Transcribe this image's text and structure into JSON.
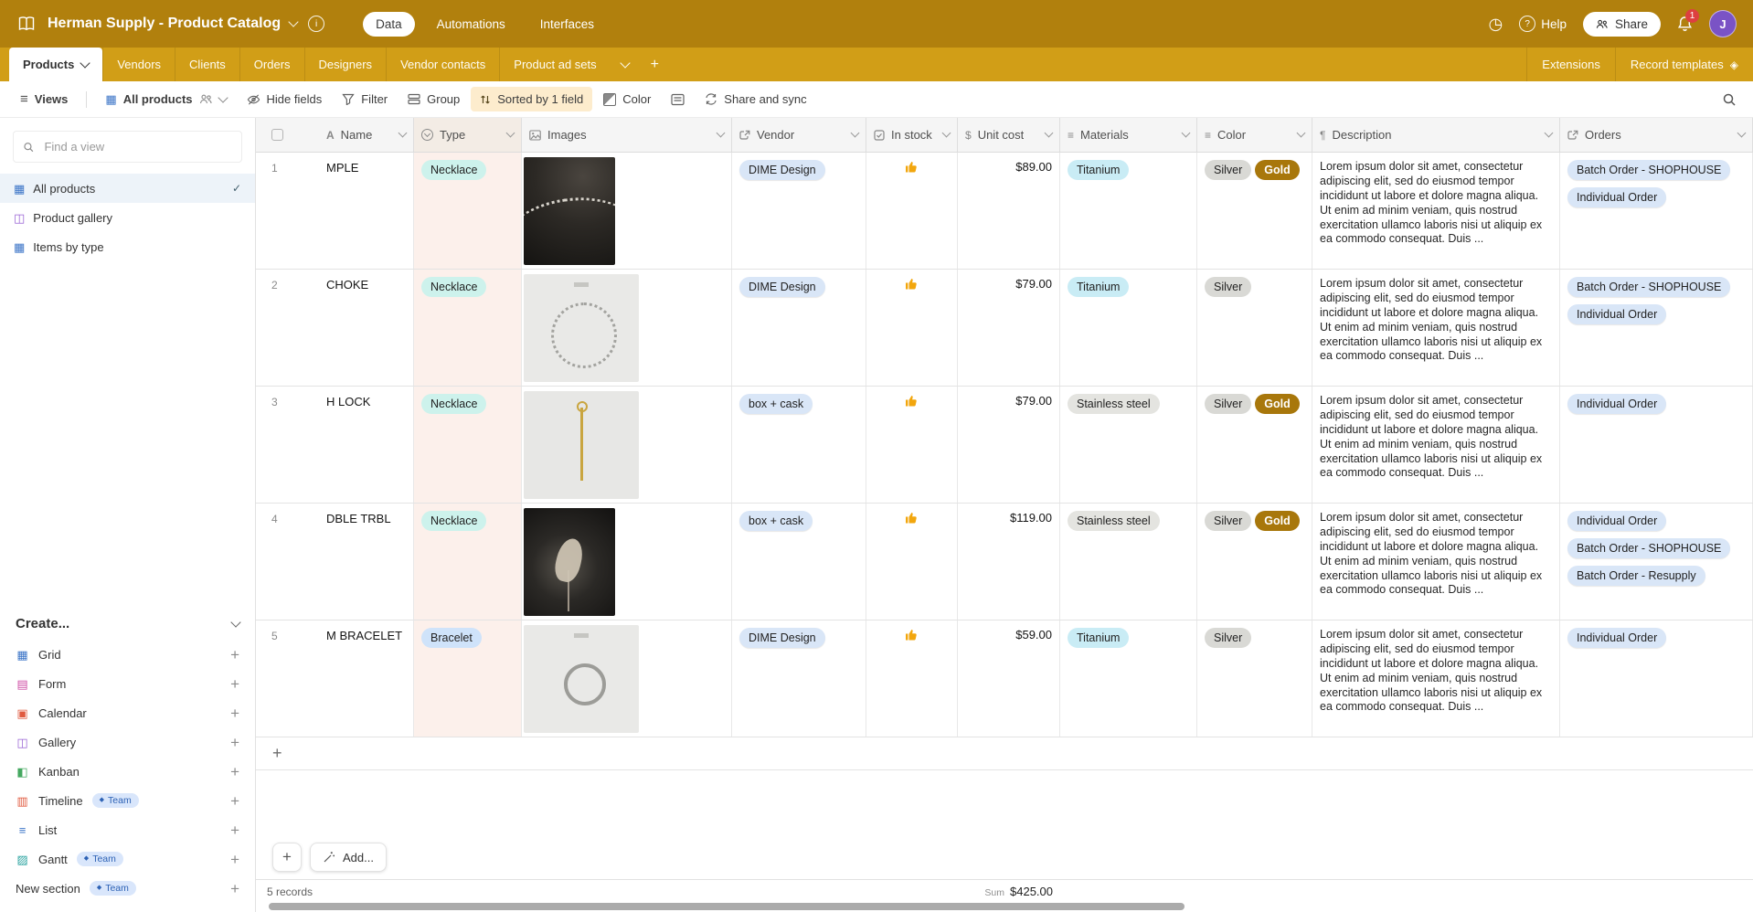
{
  "app": {
    "title": "Herman Supply - Product Catalog",
    "nav": {
      "items": [
        "Data",
        "Automations",
        "Interfaces"
      ],
      "active": "Data"
    },
    "help_label": "Help",
    "share_label": "Share",
    "notification_count": "1",
    "avatar_initial": "J"
  },
  "tabbar": {
    "tabs": [
      "Products",
      "Vendors",
      "Clients",
      "Orders",
      "Designers",
      "Vendor contacts",
      "Product ad sets"
    ],
    "active_tab": "Products",
    "extensions_label": "Extensions",
    "record_templates_label": "Record templates"
  },
  "toolbar": {
    "views_label": "Views",
    "view_name": "All products",
    "hide_fields_label": "Hide fields",
    "filter_label": "Filter",
    "group_label": "Group",
    "sort_label": "Sorted by 1 field",
    "color_label": "Color",
    "share_sync_label": "Share and sync"
  },
  "sidebar": {
    "search_placeholder": "Find a view",
    "views": [
      {
        "label": "All products",
        "selected": true
      },
      {
        "label": "Product gallery",
        "selected": false
      },
      {
        "label": "Items by type",
        "selected": false
      }
    ],
    "create_label": "Create...",
    "create_items": [
      {
        "label": "Grid",
        "badge": null
      },
      {
        "label": "Form",
        "badge": null
      },
      {
        "label": "Calendar",
        "badge": null
      },
      {
        "label": "Gallery",
        "badge": null
      },
      {
        "label": "Kanban",
        "badge": null
      },
      {
        "label": "Timeline",
        "badge": "Team"
      },
      {
        "label": "List",
        "badge": null
      },
      {
        "label": "Gantt",
        "badge": "Team"
      },
      {
        "label": "New section",
        "badge": "Team"
      }
    ]
  },
  "grid": {
    "columns": [
      "Name",
      "Type",
      "Images",
      "Vendor",
      "In stock",
      "Unit cost",
      "Materials",
      "Color",
      "Description",
      "Orders"
    ],
    "description_text": "Lorem ipsum dolor sit amet, consectetur adipiscing elit, sed do eiusmod tempor incididunt ut labore et dolore magna aliqua. Ut enim ad minim veniam, quis nostrud exercitation ullamco laboris nisi ut aliquip ex ea commodo consequat. Duis ...",
    "rows": [
      {
        "num": "1",
        "name": "MPLE",
        "type": {
          "label": "Necklace",
          "color": "teal"
        },
        "image": "photo-necklace-model",
        "vendor": "DIME Design",
        "in_stock": true,
        "unit_cost": "$89.00",
        "materials": [
          {
            "label": "Titanium",
            "color": "cyan"
          }
        ],
        "colors": [
          {
            "label": "Silver",
            "color": "silver"
          },
          {
            "label": "Gold",
            "color": "gold"
          }
        ],
        "orders": [
          "Batch Order - SHOPHOUSE",
          "Individual Order"
        ]
      },
      {
        "num": "2",
        "name": "CHOKE",
        "type": {
          "label": "Necklace",
          "color": "teal"
        },
        "image": "photo-chain-circle",
        "vendor": "DIME Design",
        "in_stock": true,
        "unit_cost": "$79.00",
        "materials": [
          {
            "label": "Titanium",
            "color": "cyan"
          }
        ],
        "colors": [
          {
            "label": "Silver",
            "color": "silver"
          }
        ],
        "orders": [
          "Batch Order - SHOPHOUSE",
          "Individual Order"
        ]
      },
      {
        "num": "3",
        "name": "H LOCK",
        "type": {
          "label": "Necklace",
          "color": "teal"
        },
        "image": "photo-pendant",
        "vendor": "box + cask",
        "in_stock": true,
        "unit_cost": "$79.00",
        "materials": [
          {
            "label": "Stainless steel",
            "color": "gray"
          }
        ],
        "colors": [
          {
            "label": "Silver",
            "color": "silver"
          },
          {
            "label": "Gold",
            "color": "gold"
          }
        ],
        "orders": [
          "Individual Order"
        ]
      },
      {
        "num": "4",
        "name": "DBLE TRBL",
        "type": {
          "label": "Necklace",
          "color": "teal"
        },
        "image": "photo-hand-chain",
        "vendor": "box + cask",
        "in_stock": true,
        "unit_cost": "$119.00",
        "materials": [
          {
            "label": "Stainless steel",
            "color": "gray"
          }
        ],
        "colors": [
          {
            "label": "Silver",
            "color": "silver"
          },
          {
            "label": "Gold",
            "color": "gold"
          }
        ],
        "orders": [
          "Individual Order",
          "Batch Order - SHOPHOUSE",
          "Batch Order - Resupply"
        ]
      },
      {
        "num": "5",
        "name": "M BRACELET",
        "type": {
          "label": "Bracelet",
          "color": "blue"
        },
        "image": "photo-bracelet-circle",
        "vendor": "DIME Design",
        "in_stock": true,
        "unit_cost": "$59.00",
        "materials": [
          {
            "label": "Titanium",
            "color": "cyan"
          }
        ],
        "colors": [
          {
            "label": "Silver",
            "color": "silver"
          }
        ],
        "orders": [
          "Individual Order"
        ]
      }
    ],
    "add_record_label": "Add...",
    "footer": {
      "records_count": "5 records",
      "sum_label": "Sum",
      "sum_value": "$425.00"
    }
  },
  "colors": {
    "topbar_gold": "#b1800d",
    "tabbar_gold": "#d19e17",
    "sort_highlight": "#fdeccd",
    "gold_chip": "#a8770b",
    "linked_chip": "#d9e6f7",
    "sorted_column_tint": "#fcf0eb",
    "notification_red": "#dd4040",
    "avatar_purple": "#7a53c5"
  }
}
